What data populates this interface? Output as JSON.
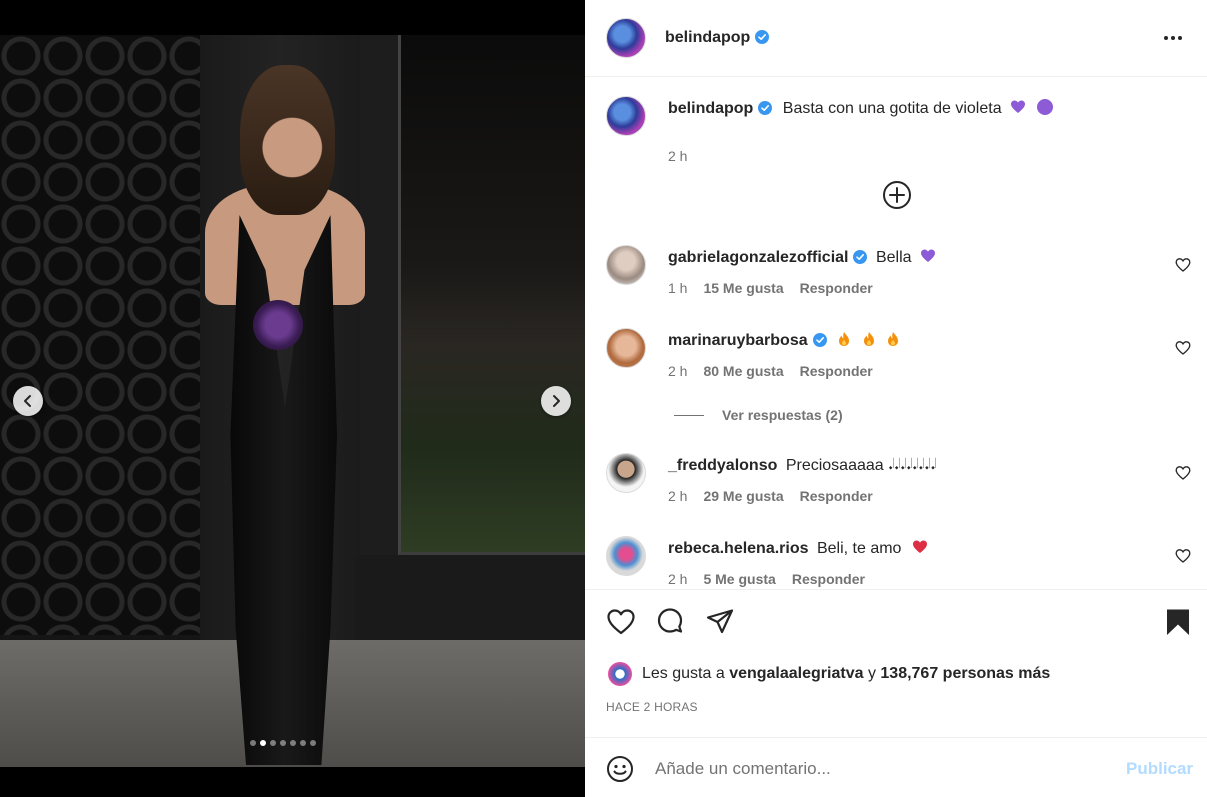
{
  "post": {
    "username": "belindapop",
    "caption": "Basta con una gotita de violeta",
    "caption_time": "2 h",
    "carousel_count": 7,
    "carousel_active": 1
  },
  "comments": [
    {
      "username": "gabrielagonzalezofficial",
      "verified": true,
      "text": "Bella",
      "time": "1 h",
      "likes": "15 Me gusta",
      "reply": "Responder"
    },
    {
      "username": "marinaruybarbosa",
      "verified": true,
      "text": "",
      "time": "2 h",
      "likes": "80 Me gusta",
      "reply": "Responder"
    },
    {
      "username": "_freddyalonso",
      "verified": false,
      "text": "Preciosaaaaa 𝆺𝅥𝆺𝅥𝆺𝅥𝆺𝅥𝆺𝅥𝆺𝅥𝆺𝅥𝆺𝅥",
      "time": "2 h",
      "likes": "29 Me gusta",
      "reply": "Responder"
    },
    {
      "username": "rebeca.helena.rios",
      "verified": false,
      "text": "Beli, te amo",
      "time": "2 h",
      "likes": "5 Me gusta",
      "reply": "Responder"
    }
  ],
  "view_replies": "Ver respuestas (2)",
  "likes_summary": {
    "prefix": "Les gusta a",
    "user": "vengalaalegriatva",
    "connector": "y",
    "others": "138,767 personas más"
  },
  "timestamp": "HACE 2 HORAS",
  "add_comment": {
    "placeholder": "Añade un comentario...",
    "publish_label": "Publicar"
  },
  "colors": {
    "verified": "#3897f0",
    "heart_purple": "#8e5bd6",
    "heart_red": "#ed4956",
    "publish_disabled": "#b3dbff"
  },
  "icons": [
    "verified-badge-icon",
    "more-options-icon",
    "load-more-icon",
    "heart-icon",
    "comment-icon",
    "share-icon",
    "bookmark-icon",
    "smile-icon",
    "chevron-left-icon",
    "chevron-right-icon"
  ]
}
